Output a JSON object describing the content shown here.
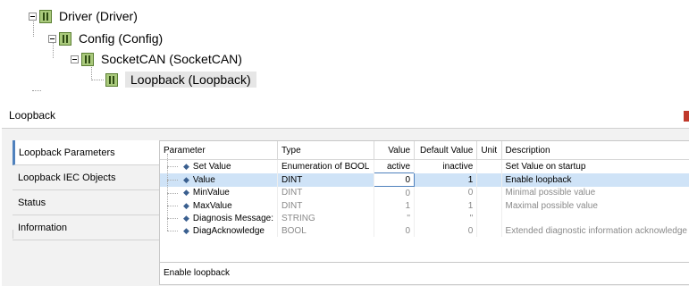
{
  "tree": {
    "nodes": [
      {
        "label": "Driver (Driver)",
        "expanded": true
      },
      {
        "label": "Config (Config)",
        "expanded": true
      },
      {
        "label": "SocketCAN (SocketCAN)",
        "expanded": true
      },
      {
        "label": "Loopback (Loopback)",
        "selected": true
      }
    ]
  },
  "editor": {
    "title": "Loopback",
    "tabs": [
      {
        "label": "Loopback Parameters",
        "active": true
      },
      {
        "label": "Loopback IEC Objects"
      },
      {
        "label": "Status"
      },
      {
        "label": "Information"
      }
    ],
    "table": {
      "columns": [
        "Parameter",
        "Type",
        "Value",
        "Default Value",
        "Unit",
        "Description"
      ],
      "rows": [
        {
          "parameter": "Set Value",
          "type": "Enumeration of BOOL",
          "value": "active",
          "default": "inactive",
          "unit": "",
          "description": "Set Value on startup",
          "state": "normal"
        },
        {
          "parameter": "Value",
          "type": "DINT",
          "value": "0",
          "default": "1",
          "unit": "",
          "description": "Enable loopback",
          "state": "selected"
        },
        {
          "parameter": "MinValue",
          "type": "DINT",
          "value": "0",
          "default": "0",
          "unit": "",
          "description": "Minimal possible value",
          "state": "dim"
        },
        {
          "parameter": "MaxValue",
          "type": "DINT",
          "value": "1",
          "default": "1",
          "unit": "",
          "description": "Maximal possible value",
          "state": "dim"
        },
        {
          "parameter": "Diagnosis Message:",
          "type": "STRING",
          "value": "''",
          "default": "''",
          "unit": "",
          "description": "",
          "state": "dim"
        },
        {
          "parameter": "DiagAcknowledge",
          "type": "BOOL",
          "value": "0",
          "default": "0",
          "unit": "",
          "description": "Extended diagnostic information acknowledge",
          "state": "dim"
        }
      ]
    },
    "status_text": "Enable loopback"
  },
  "colors": {
    "accent": "#4f81bd",
    "selection": "#cfe3f7",
    "dim_text": "#8a8a8a",
    "close_button": "#c0392b"
  },
  "icons": {
    "tree_node": "device-icon",
    "parameter": "parameter-icon",
    "expander": "collapse-icon"
  }
}
